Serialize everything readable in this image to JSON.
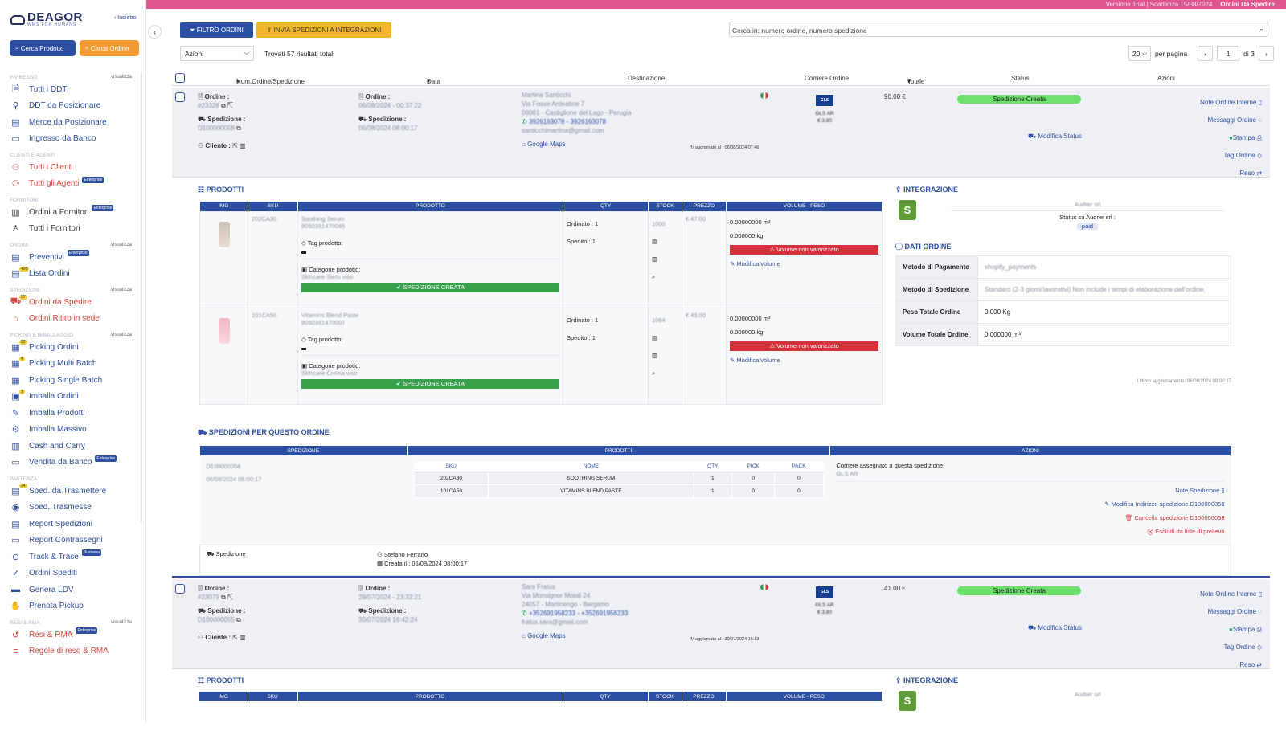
{
  "topbar": {
    "trial": "Versione Trial | Scadenza 15/08/2024",
    "current": "Ordini Da Spedire"
  },
  "sidebar": {
    "logo_name": "DEAGOR",
    "logo_sub": "WMS FOR HUMANS",
    "back_label": "Indietro",
    "search_product": "Cerca Prodotto",
    "search_order": "Cerca Ordine",
    "view_all": "visualizza",
    "sections": [
      {
        "title": "INGRESSO",
        "items": [
          {
            "label": "Tutti i DDT",
            "icon": "document-icon"
          },
          {
            "label": "DDT da Posizionare",
            "icon": "ddt-position-icon"
          },
          {
            "label": "Merce da Posizionare",
            "icon": "goods-icon"
          },
          {
            "label": "Ingresso da Banco",
            "icon": "monitor-icon"
          }
        ]
      },
      {
        "title": "CLIENTI E AGENTI",
        "items": [
          {
            "label": "Tutti i Clienti",
            "icon": "users-icon"
          },
          {
            "label": "Tutti gli Agenti",
            "icon": "agents-icon",
            "badge": "Enterprise"
          }
        ]
      },
      {
        "title": "FORNITORI",
        "items": [
          {
            "label": "Ordini a Fornitori",
            "icon": "supplier-orders-icon",
            "badge": "Enterprise"
          },
          {
            "label": "Tutti i Fornitori",
            "icon": "suppliers-icon"
          }
        ]
      },
      {
        "title": "ORDINI",
        "items": [
          {
            "label": "Preventivi",
            "icon": "quote-icon",
            "badge": "Enterprise"
          },
          {
            "label": "Lista Ordini",
            "icon": "orders-list-icon",
            "count": "+99"
          }
        ]
      },
      {
        "title": "SPEDIZIONI",
        "items": [
          {
            "label": "Ordini da Spedire",
            "icon": "truck-icon",
            "count": "57"
          },
          {
            "label": "Ordini Ritiro in sede",
            "icon": "store-pickup-icon"
          }
        ]
      },
      {
        "title": "PICKING E IMBALLAGGIO",
        "items": [
          {
            "label": "Picking Ordini",
            "icon": "picking-icon",
            "count": "22"
          },
          {
            "label": "Picking Multi Batch",
            "icon": "multi-batch-icon",
            "count": "4"
          },
          {
            "label": "Picking Single Batch",
            "icon": "single-batch-icon"
          },
          {
            "label": "Imballa Ordini",
            "icon": "box-icon",
            "count": "1"
          },
          {
            "label": "Imballa Prodotti",
            "icon": "pack-products-icon"
          },
          {
            "label": "Imballa Massivo",
            "icon": "mass-pack-icon"
          },
          {
            "label": "Cash and Carry",
            "icon": "shelves-icon"
          },
          {
            "label": "Vendita da Banco",
            "icon": "counter-sale-icon",
            "badge": "Enterprise"
          }
        ]
      },
      {
        "title": "PARTENZA",
        "items": [
          {
            "label": "Sped. da Trasmettere",
            "icon": "transmit-icon",
            "count": "24"
          },
          {
            "label": "Sped. Trasmesse",
            "icon": "signal-icon"
          },
          {
            "label": "Report Spedizioni",
            "icon": "report-icon"
          },
          {
            "label": "Report Contrassegni",
            "icon": "cash-report-icon"
          },
          {
            "label": "Track & Trace",
            "icon": "track-icon",
            "badge": "Business"
          },
          {
            "label": "Ordini Spediti",
            "icon": "shipped-icon"
          },
          {
            "label": "Genera LDV",
            "icon": "label-icon"
          },
          {
            "label": "Prenota Pickup",
            "icon": "handshake-icon"
          }
        ]
      },
      {
        "title": "RESI & RMA",
        "items": [
          {
            "label": "Resi & RMA",
            "icon": "return-icon",
            "badge": "Enterprise"
          },
          {
            "label": "Regole di reso & RMA",
            "icon": "rules-icon"
          }
        ]
      }
    ]
  },
  "toolbar": {
    "filter_label": "FILTRO ORDINI",
    "send_label": "INVIA SPEDIZIONI A INTEGRAZIONI",
    "search_placeholder": "Cerca in: numero ordine, numero spedizione",
    "actions_select": "Azioni",
    "found_text": "Trovati 57 risultati totali",
    "per_page": "20",
    "per_page_label": "per pagina",
    "page": "1",
    "of_pages": "di 3"
  },
  "table": {
    "headers": {
      "num": "Num.Ordine/Spedizione",
      "date": "Data",
      "dest": "Destinazione",
      "carrier": "Corriere Ordine",
      "total": "Totale",
      "status": "Status",
      "actions": "Azioni"
    }
  },
  "labels": {
    "ordine": "Ordine :",
    "spedizione": "Spedizione :",
    "cliente": "Cliente :",
    "google_maps": "Google Maps",
    "modifica_status": "Modifica Status",
    "note_ordine": "Note Ordine Interne",
    "messaggi": "Messaggi Ordine",
    "stampa": "Stampa",
    "tag_ordine": "Tag Ordine",
    "reso": "Reso",
    "prodotti": "PRODOTTI",
    "integrazione": "INTEGRAZIONE",
    "dati_ordine": "DATI ORDINE",
    "spedizioni_ordine": "SPEDIZIONI PER QUESTO ORDINE",
    "tag_prodotto": "Tag prodotto:",
    "categorie": "Categorie prodotto:",
    "ordinato": "Ordinato : 1",
    "spedito": "Spedito : 1",
    "volume_non_val": "Volume non valorizzato",
    "modifica_volume": "Modifica volume",
    "spedizione_creata_bar": "SPEDIZIONE CREATA"
  },
  "orders": [
    {
      "order_no": "#23328",
      "ship_no": "D100000058",
      "order_date": "06/08/2024 - 00:37:22",
      "ship_date": "06/08/2024 08:00:17",
      "dest_name": "Martina Santicchi",
      "dest_addr1": "Via Fosse Ardeatine 7",
      "dest_addr2": "06061 - Castiglione del Lago - Perugia",
      "dest_phone": "3926163078 - 3926163078",
      "dest_email": "santicchimartina@gmail.com",
      "updated": "aggiornato al : 06/08/2024 07:46",
      "carrier_logo": "GLS",
      "carrier_name": "GLS AR",
      "carrier_price": "€ 3.80",
      "total": "90.00 €",
      "status": "Spedizione Creata"
    },
    {
      "order_no": "#23079",
      "ship_no": "D100000055",
      "order_date": "29/07/2024 - 23:32:21",
      "ship_date": "30/07/2024 16:42:24",
      "dest_name": "Sara Fratus",
      "dest_addr1": "Via Monsignor Moioli 24",
      "dest_addr2": "24057 - Martinengo - Bergamo",
      "dest_phone": "+352691958233 - +352691958233",
      "dest_email": "fratus.sara@gmail.com",
      "updated": "aggiornato al : 30/07/2024 16:13",
      "carrier_logo": "GLS",
      "carrier_name": "GLS AR",
      "carrier_price": "€ 3.80",
      "total": "41.00 €",
      "status": "Spedizione Creata"
    }
  ],
  "products_table": {
    "headers": [
      "IMG",
      "SKU",
      "PRODOTTO",
      "QTY",
      "STOCK",
      "PREZZO",
      "VOLUME - PESO"
    ],
    "rows": [
      {
        "sku": "202CA30",
        "name": "Soothing Serum",
        "ean": "8050391470045",
        "category": "Skincare Siero viso",
        "stock": "1000",
        "price": "€ 47.00",
        "volume": "0.00000000 m³",
        "weight": "0.000000 kg"
      },
      {
        "sku": "101CA50",
        "name": "Vitamins Blend Paste",
        "ean": "8050391470007",
        "category": "Skincare Crema viso",
        "stock": "1064",
        "price": "€ 43.00",
        "volume": "0.00000000 m³",
        "weight": "0.000000 kg"
      }
    ]
  },
  "integration": {
    "shop": "Audrer srl",
    "status_label": "Status su Audrer srl :",
    "status_value": "paid"
  },
  "dati_ordine": [
    {
      "k": "Metodo di Pagamento",
      "v": "shopify_payments"
    },
    {
      "k": "Metodo di Spedizione",
      "v": "Standard (2-3 giorni lavorativi) Non include i tempi di elaborazione dell'ordine."
    },
    {
      "k": "Peso Totale Ordine",
      "v": "0.000 Kg"
    },
    {
      "k": "Volume Totale Ordine",
      "v": "0.000000 m³"
    }
  ],
  "last_update": "Ultimo aggiornamento: 06/08/2024 08:00:17",
  "shipments": {
    "headers": [
      "SPEDIZIONE",
      "PRODOTTI",
      "AZIONI"
    ],
    "inner_headers": [
      "SKU",
      "NOME",
      "QTY",
      "PICK",
      "PACK"
    ],
    "ship_no": "D100000058",
    "ship_date": "06/08/2024 08:00:17",
    "rows": [
      {
        "sku": "202CA30",
        "name": "SOOTHING SERUM",
        "qty": "1",
        "pick": "0",
        "pack": "0"
      },
      {
        "sku": "101CA50",
        "name": "VITAMINS BLEND PASTE",
        "qty": "1",
        "pick": "0",
        "pack": "0"
      }
    ],
    "carrier_assigned": "Corriere assegnato a questa spedizione:",
    "carrier": "GLS AR",
    "note": "Note Spedizione",
    "modify_addr": "Modifica Indirizzo spedizione D100000058",
    "cancel": "Cancella spedizione D100000058",
    "exclude": "Escludi da liste di prelievo",
    "footer_label": "Spedizione",
    "user": "Stefano Ferrario",
    "created": "Creata il : 06/08/2024 08:00:17"
  }
}
